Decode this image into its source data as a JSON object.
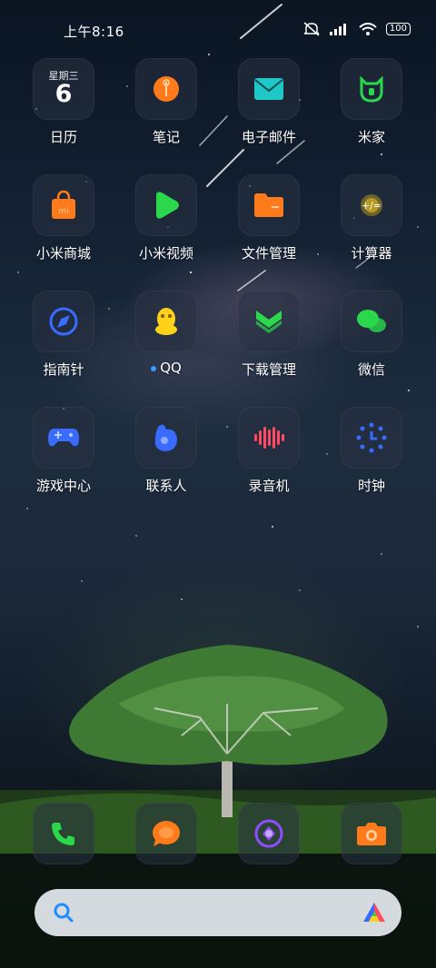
{
  "status_bar": {
    "time": "上午8:16",
    "battery": "100"
  },
  "calendar": {
    "weekday": "星期三",
    "day": "6"
  },
  "apps": [
    {
      "label": "日历"
    },
    {
      "label": "笔记"
    },
    {
      "label": "电子邮件"
    },
    {
      "label": "米家"
    },
    {
      "label": "小米商城"
    },
    {
      "label": "小米视频"
    },
    {
      "label": "文件管理"
    },
    {
      "label": "计算器"
    },
    {
      "label": "指南针"
    },
    {
      "label": "QQ"
    },
    {
      "label": "下载管理"
    },
    {
      "label": "微信"
    },
    {
      "label": "游戏中心"
    },
    {
      "label": "联系人"
    },
    {
      "label": "录音机"
    },
    {
      "label": "时钟"
    }
  ],
  "dock": [
    {
      "icon": "phone-icon"
    },
    {
      "icon": "messages-icon"
    },
    {
      "icon": "browser-icon"
    },
    {
      "icon": "camera-icon"
    }
  ],
  "search": {
    "placeholder": ""
  },
  "colors": {
    "orange": "#ff7a1a",
    "teal": "#1fc7c7",
    "green": "#2bd84b",
    "blue": "#3a6bff",
    "yellow": "#ffd21a",
    "red": "#ff4a63",
    "purple": "#8e4dff"
  }
}
